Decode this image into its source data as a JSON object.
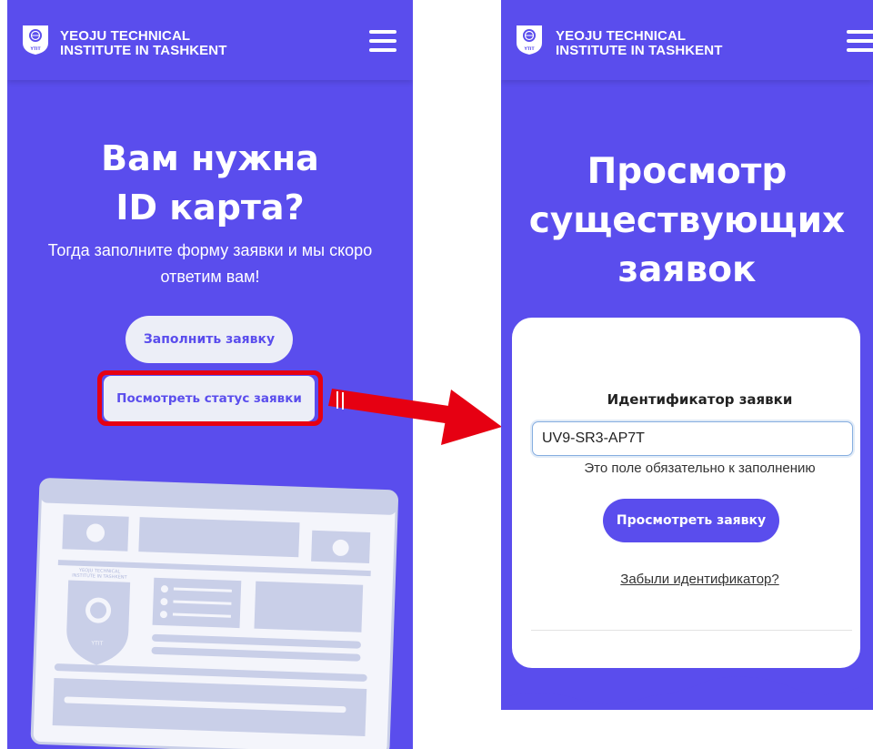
{
  "left": {
    "header": {
      "logo_line1": "YEOJU TECHNICAL",
      "logo_line2": "INSTITUTE IN TASHKENT",
      "logo_badge": "YTIT"
    },
    "hero": {
      "title_line1": "Вам нужна",
      "title_line2": "ID карта?",
      "subtitle_line1": "Тогда заполните форму заявки и мы скоро",
      "subtitle_line2": "ответим вам!"
    },
    "buttons": {
      "fill_application": "Заполнить заявку",
      "view_status": "Посмотреть статус заявки"
    },
    "illustration": {
      "card_line1": "YEOJU TECHNICAL",
      "card_line2": "INSTITUTE IN TASHKENT",
      "badge": "YTIT"
    }
  },
  "right": {
    "header": {
      "logo_line1": "YEOJU TECHNICAL",
      "logo_line2": "INSTITUTE IN TASHKENT",
      "logo_badge": "YTIT"
    },
    "hero": {
      "title_line1": "Просмотр",
      "title_line2": "существующих",
      "title_line3": "заявок"
    },
    "form": {
      "label": "Идентификатор заявки",
      "value": "UV9-SR3-AP7T",
      "helper": "Это поле обязательно к заполнению",
      "submit": "Просмотреть заявку",
      "forgot_link": "Забыли идентификатор?"
    }
  },
  "colors": {
    "brand_purple": "#5a4ded",
    "highlight_red": "#e60012",
    "button_light": "#eceef7",
    "illustration": "#c9cfe8"
  },
  "icons": [
    "shield-logo-icon",
    "hamburger-menu-icon",
    "arrow-annotation-icon"
  ]
}
